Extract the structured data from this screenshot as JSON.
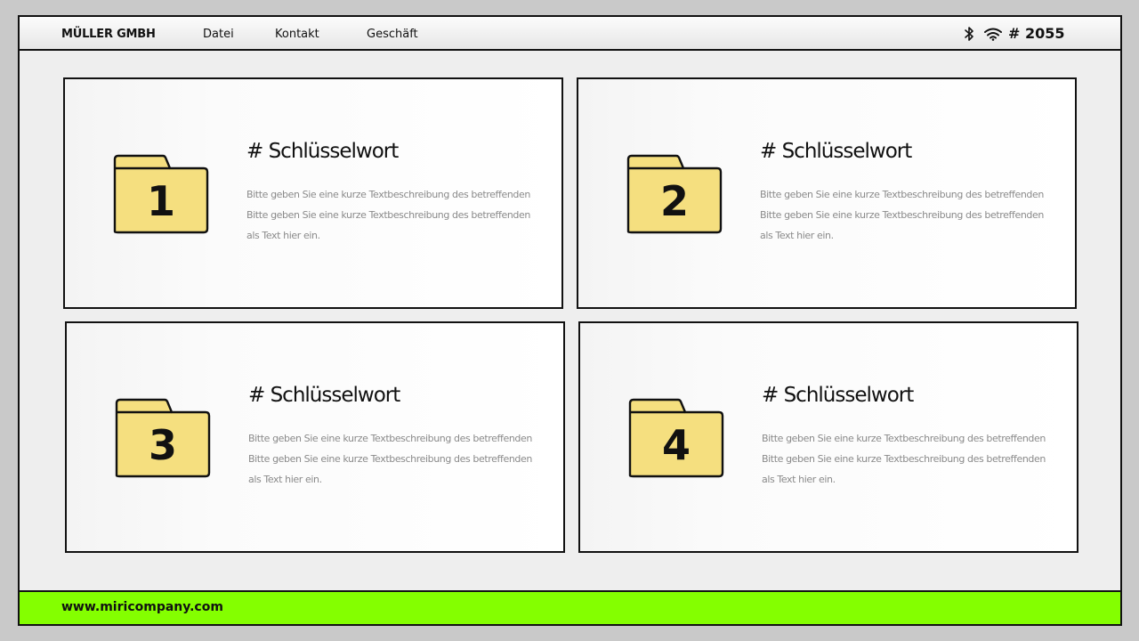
{
  "header": {
    "brand": "MÜLLER GMBH",
    "nav": [
      "Datei",
      "Kontakt",
      "Geschäft"
    ],
    "status_number": "# 2055"
  },
  "cards": [
    {
      "number": "1",
      "title": "# Schlüsselwort",
      "lines": [
        "Bitte geben Sie eine kurze Textbeschreibung des betreffenden",
        "Bitte geben Sie eine kurze Textbeschreibung des betreffenden",
        "als Text hier ein."
      ]
    },
    {
      "number": "2",
      "title": "# Schlüsselwort",
      "lines": [
        "Bitte geben Sie eine kurze Textbeschreibung des betreffenden",
        "Bitte geben Sie eine kurze Textbeschreibung des betreffenden",
        "als Text hier ein."
      ]
    },
    {
      "number": "3",
      "title": "# Schlüsselwort",
      "lines": [
        "Bitte geben Sie eine kurze Textbeschreibung des betreffenden",
        "Bitte geben Sie eine kurze Textbeschreibung des betreffenden",
        "als Text hier ein."
      ]
    },
    {
      "number": "4",
      "title": "# Schlüsselwort",
      "lines": [
        "Bitte geben Sie eine kurze Textbeschreibung des betreffenden",
        "Bitte geben Sie eine kurze Textbeschreibung des betreffenden",
        "als Text hier ein."
      ]
    }
  ],
  "footer": {
    "url": "www.miricompany.com"
  },
  "icons": {
    "folder": "folder-icon",
    "bluetooth": "bluetooth-icon",
    "wifi": "wifi-icon"
  },
  "colors": {
    "accent": "#84ff00",
    "folder_fill": "#f5df7f",
    "background": "#eeeeee",
    "border": "#111111"
  }
}
